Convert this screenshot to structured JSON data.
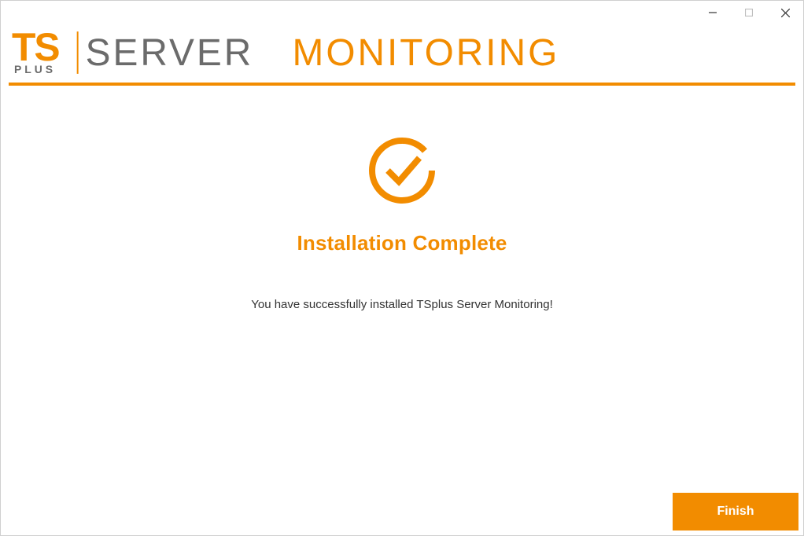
{
  "colors": {
    "accent": "#f28c00",
    "gray": "#6b6b6b"
  },
  "logo": {
    "ts": "TS",
    "plus": "PLUS",
    "server": "SERVER",
    "monitoring": "MONITORING"
  },
  "main": {
    "title": "Installation Complete",
    "message": "You have successfully installed TSplus Server Monitoring!"
  },
  "footer": {
    "finish_label": "Finish"
  }
}
